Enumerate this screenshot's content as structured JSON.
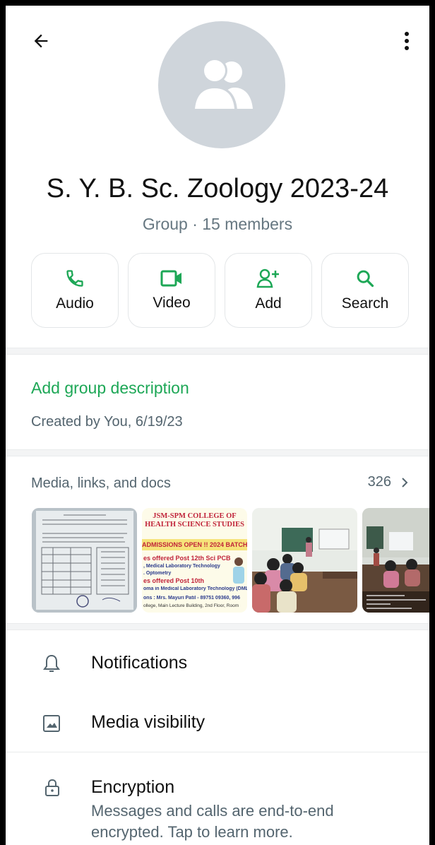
{
  "header": {
    "back_icon": "arrow-left-icon",
    "menu_icon": "more-vertical-icon"
  },
  "group": {
    "name": "S. Y. B. Sc. Zoology 2023-24",
    "subtitle": "Group · 15 members",
    "avatar_icon": "group-icon"
  },
  "actions": [
    {
      "label": "Audio",
      "icon": "phone-icon"
    },
    {
      "label": "Video",
      "icon": "video-icon"
    },
    {
      "label": "Add",
      "icon": "add-person-icon"
    },
    {
      "label": "Search",
      "icon": "search-icon"
    }
  ],
  "description": {
    "add_label": "Add group description",
    "created": "Created by You, 6/19/23"
  },
  "media": {
    "header": "Media, links, and docs",
    "count": "326",
    "thumbs": {
      "t2_line1": "JSM-SPM COLLEGE OF",
      "t2_line2": "HEALTH SCIENCE STUDIES",
      "t2_banner": "ADMISSIONS OPEN !! 2024 BATCH",
      "t2_c1": "es offered Post 12th Sci PCB",
      "t2_c2": ", Medical Laboratory Technology",
      "t2_c3": ". Optometry",
      "t2_c4": "es offered Post 10th",
      "t2_c5": "oma in Medical Laboratory Technology (DML",
      "t2_c6": "ons : Mrs. Mayuri Patil - 89751 09360, 996",
      "t2_c7": "ollege, Main Lecture Building, 2nd Floor, Room"
    }
  },
  "settings": {
    "notifications": "Notifications",
    "media_visibility": "Media visibility",
    "encryption": "Encryption",
    "encryption_sub": "Messages and calls are end-to-end encrypted. Tap to learn more."
  },
  "colors": {
    "accent": "#1da756",
    "avatar_bg": "#cfd5db",
    "secondary_text": "#54656f"
  }
}
